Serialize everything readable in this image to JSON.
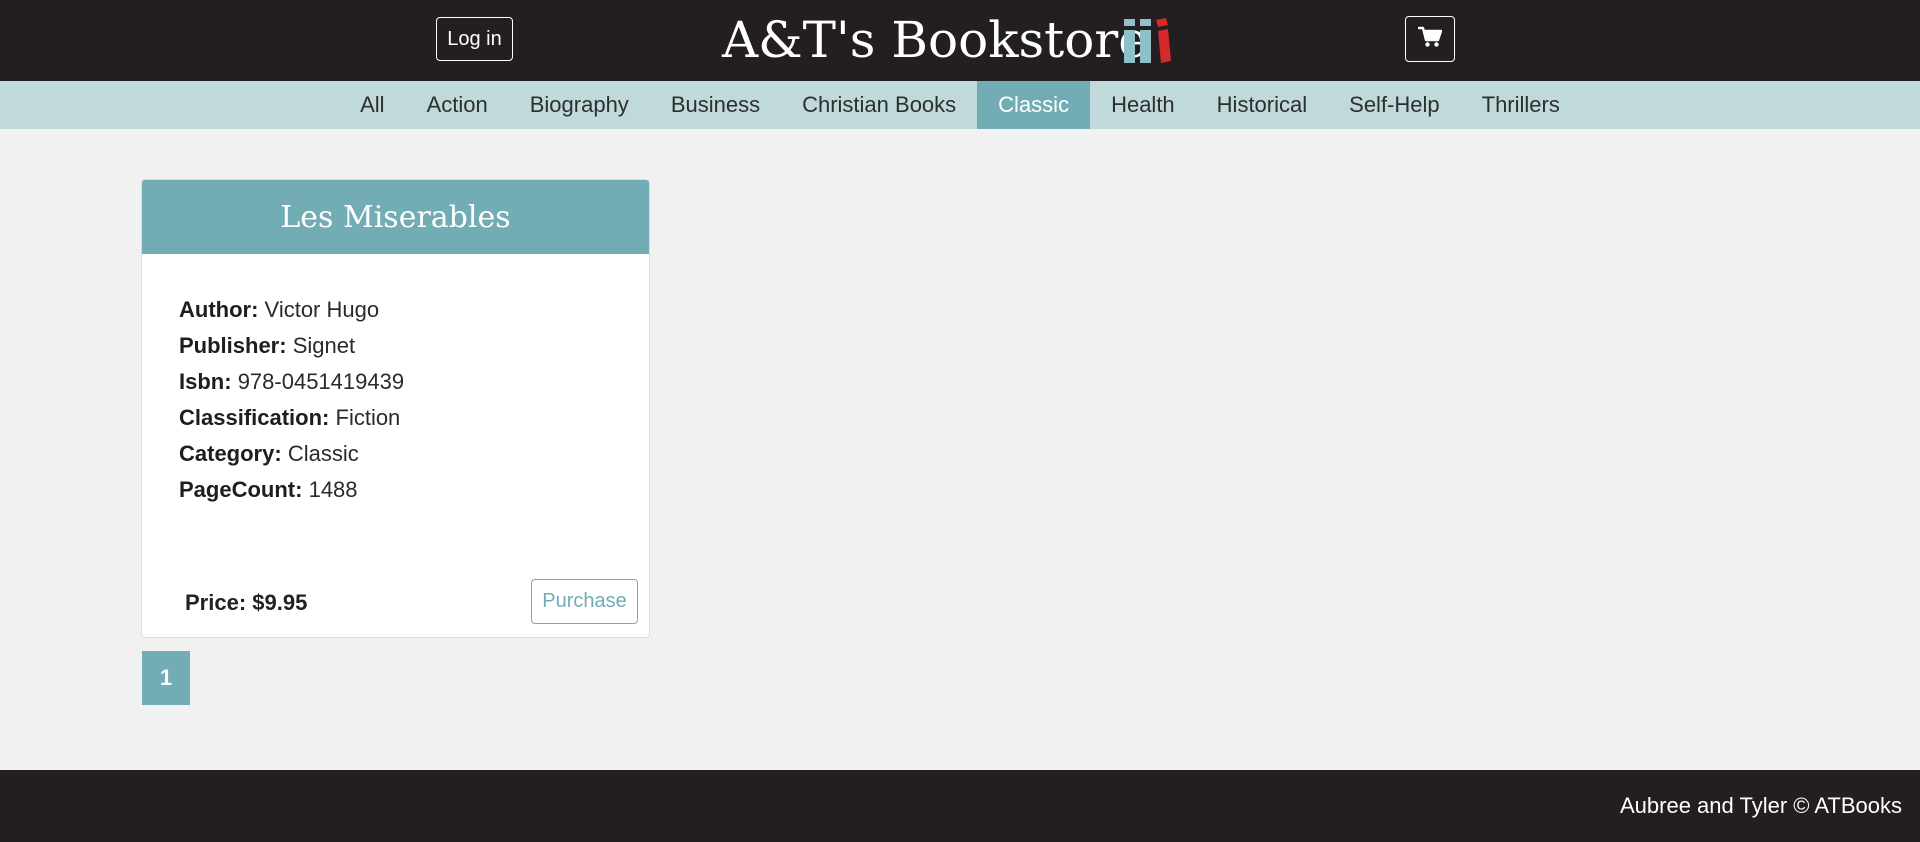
{
  "header": {
    "login_label": "Log in",
    "site_title": "A&T's Bookstore",
    "logo_icon": "books-icon",
    "cart_icon": "shopping-cart-icon"
  },
  "categories": {
    "items": [
      {
        "label": "All"
      },
      {
        "label": "Action"
      },
      {
        "label": "Biography"
      },
      {
        "label": "Business"
      },
      {
        "label": "Christian Books"
      },
      {
        "label": "Classic",
        "active": true
      },
      {
        "label": "Health"
      },
      {
        "label": "Historical"
      },
      {
        "label": "Self-Help"
      },
      {
        "label": "Thrillers"
      }
    ]
  },
  "book": {
    "title": "Les Miserables",
    "fields": [
      {
        "label": "Author:",
        "value": "Victor Hugo"
      },
      {
        "label": "Publisher:",
        "value": "Signet"
      },
      {
        "label": "Isbn:",
        "value": "978-0451419439"
      },
      {
        "label": "Classification:",
        "value": "Fiction"
      },
      {
        "label": "Category:",
        "value": "Classic"
      },
      {
        "label": "PageCount:",
        "value": "1488"
      }
    ],
    "price_label": "Price: $9.95",
    "purchase_label": "Purchase"
  },
  "pagination": {
    "current_page": "1"
  },
  "footer": {
    "text": "Aubree and Tyler © ATBooks"
  },
  "colors": {
    "header_bg": "#231e21",
    "category_bar_bg": "#c0dadb",
    "accent": "#72adb6",
    "page_bg": "#f1f1f1",
    "logo_red": "#d42a2a"
  }
}
